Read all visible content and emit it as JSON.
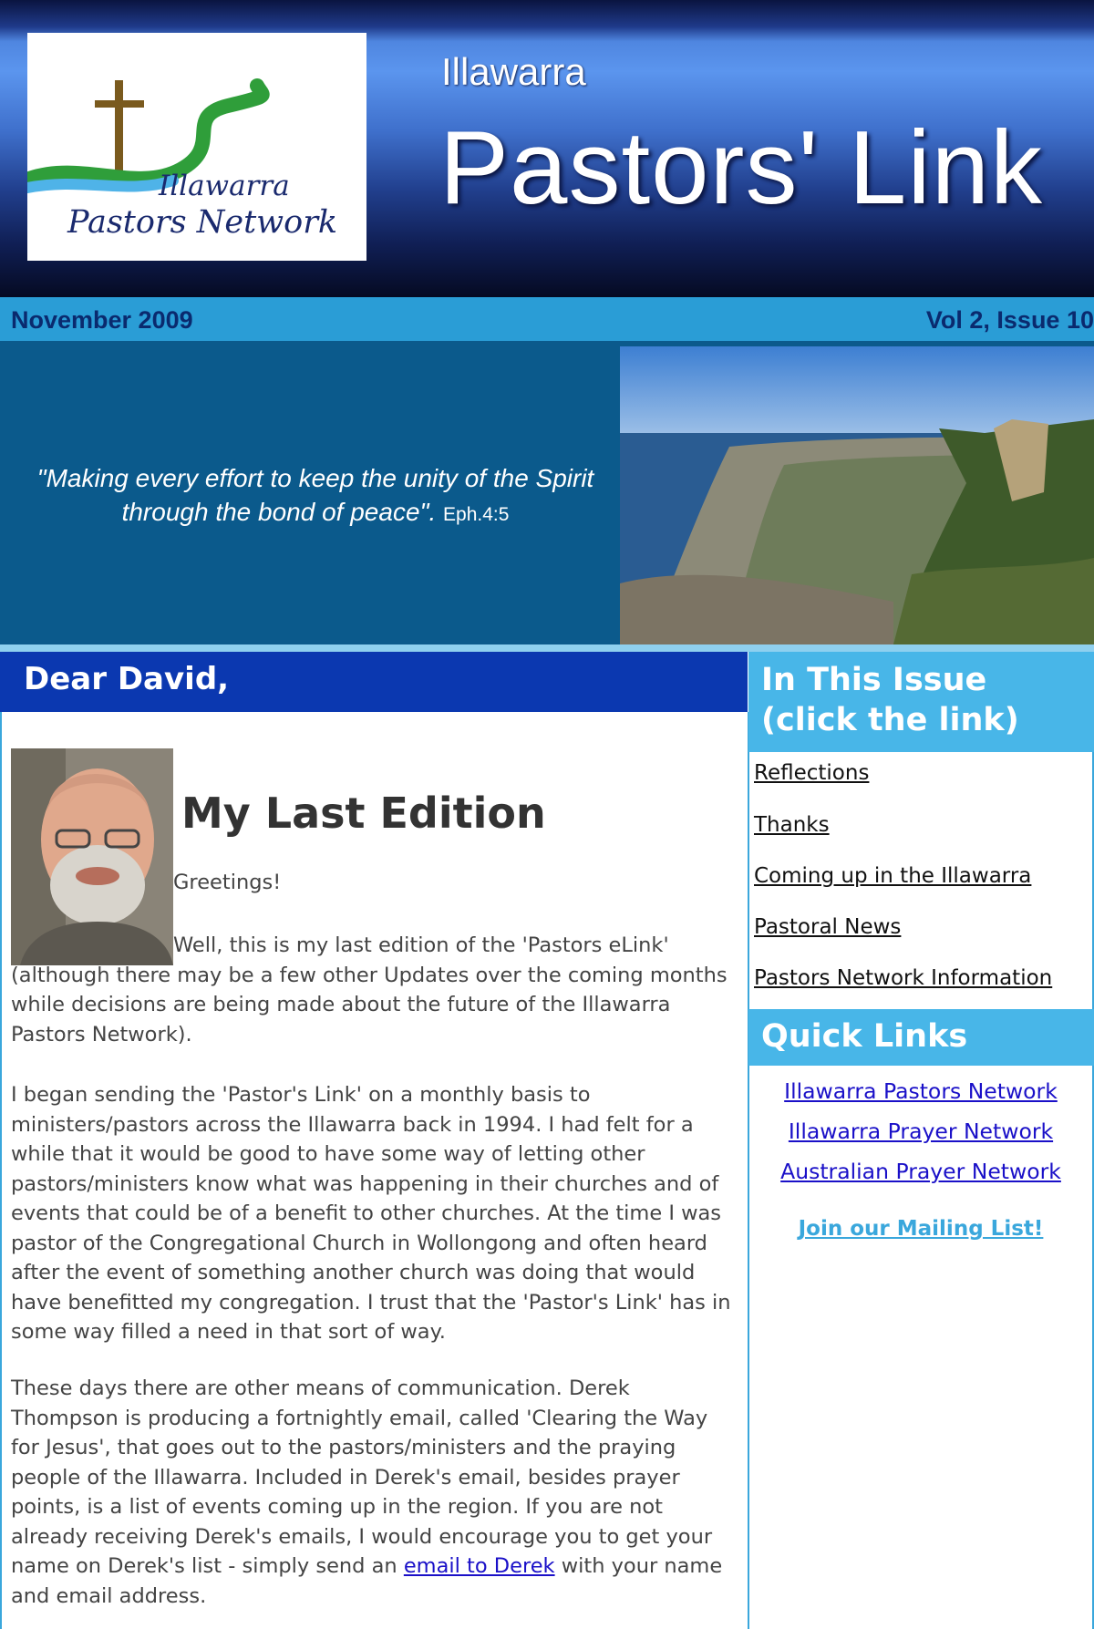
{
  "header": {
    "logo": {
      "line1": "Illawarra",
      "line2": "Pastors Network",
      "colors": {
        "cross": "#7a5a1e",
        "river_green": "#2f9e3a",
        "river_blue": "#4fb3e8",
        "text": "#1a2a6e"
      }
    },
    "region": "Illawarra",
    "title": "Pastors' Link"
  },
  "datebar": {
    "date": "November 2009",
    "issue": "Vol 2, Issue 10",
    "bg": "#2a9dd6",
    "text_color": "#0a2a6e"
  },
  "banner": {
    "quote": "\"Making every effort to  keep the unity of the Spirit through the bond of peace\".",
    "reference": "Eph.4:5",
    "bg": "#0b5a8c"
  },
  "greeting": "Dear David,",
  "article": {
    "title": "My Last Edition",
    "greeting_line": "Greetings!",
    "p1": "Well, this is my last edition of the 'Pastors eLink' (although there may be a few other Updates over the coming months while decisions are being made about the future of the Illawarra Pastors Network).",
    "p2": "I began sending the 'Pastor's Link' on a monthly basis to ministers/pastors across the Illawarra back in 1994. I had felt for a while that it would be good to have some way of letting other pastors/ministers know what was happening in their churches and of events that could be of a benefit to other churches. At the time I was pastor of the Congregational Church in Wollongong and often heard after the event of something another church was doing that would have benefitted my congregation. I trust that the 'Pastor's Link' has in some way filled a need in that sort of way.",
    "p3_before": "These days there are other means of communication. Derek Thompson is producing a fortnightly email, called 'Clearing the Way for Jesus', that goes out to the pastors/ministers and the praying people of the Illawarra. Included in Derek's email, besides prayer points, is a list of events coming up in the region. If you are not already receiving Derek's emails, I would encourage you to get your name on Derek's list - simply send an ",
    "p3_link": "email to Derek",
    "p3_after": " with your name and email address."
  },
  "sidebar": {
    "issue_heading": "In This Issue (click the link)",
    "issue_items": [
      "Reflections",
      "Thanks",
      "Coming up in the Illawarra",
      "Pastoral News",
      "Pastors Network Information"
    ],
    "quick_links_heading": "Quick Links",
    "quick_links": [
      "Illawarra Pastors Network",
      "Illawarra Prayer Network",
      "Australian Prayer Network"
    ],
    "join": "Join our Mailing List!"
  },
  "colors": {
    "greeting_bar": "#0b38b0",
    "sidebar_heading": "#48b6e8",
    "link": "#1a10c8",
    "border": "#3aa7dc"
  }
}
